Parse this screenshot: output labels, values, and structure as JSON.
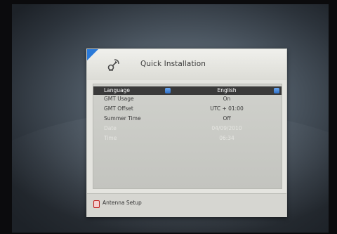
{
  "dialog": {
    "title": "Quick Installation",
    "icon": "satellite-icon"
  },
  "settings": [
    {
      "label": "Language",
      "value": "English",
      "selected": true,
      "disabled": false
    },
    {
      "label": "GMT Usage",
      "value": "On",
      "selected": false,
      "disabled": false
    },
    {
      "label": "GMT Offset",
      "value": "UTC + 01:00",
      "selected": false,
      "disabled": false
    },
    {
      "label": "Summer Time",
      "value": "Off",
      "selected": false,
      "disabled": false
    },
    {
      "label": "Date",
      "value": "04/09/2010",
      "selected": false,
      "disabled": true
    },
    {
      "label": "Time",
      "value": "06:34",
      "selected": false,
      "disabled": true
    }
  ],
  "footer": {
    "key_color": "red",
    "label": "Antenna Setup"
  },
  "colors": {
    "selection_bg": "#3a3a3a",
    "accent_blue": "#2a79d8",
    "red_key": "#c21a1a"
  }
}
